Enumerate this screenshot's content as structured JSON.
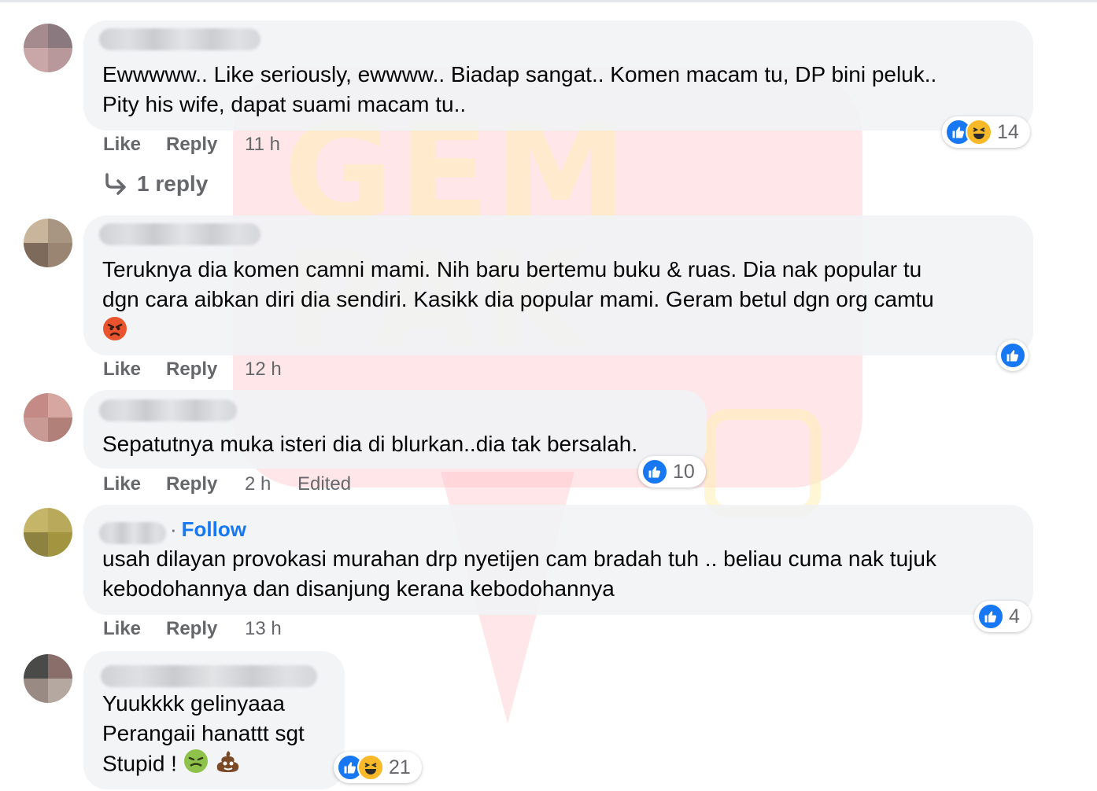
{
  "comments": [
    {
      "text_lines": [
        "Ewwwww.. Like seriously, ewwww.. Biadap sangat.. Komen macam tu, DP bini peluk..",
        "Pity his wife, dapat suami macam tu.."
      ],
      "like_label": "Like",
      "reply_label": "Reply",
      "time": "11 h",
      "reaction_count": "14",
      "reactions": [
        "like-icon",
        "haha-icon"
      ],
      "replies_link": "1 reply"
    },
    {
      "text_lines": [
        "Teruknya dia komen camni mami. Nih baru bertemu buku & ruas. Dia nak popular tu",
        "dgn cara aibkan diri dia sendiri. Kasikk dia popular mami. Geram betul dgn org camtu"
      ],
      "trailing_emoji": "angry-face-icon",
      "like_label": "Like",
      "reply_label": "Reply",
      "time": "12 h",
      "reactions": [
        "like-icon"
      ]
    },
    {
      "text_lines": [
        "Sepatutnya muka isteri dia di blurkan..dia tak bersalah."
      ],
      "like_label": "Like",
      "reply_label": "Reply",
      "time": "2 h",
      "edited_label": "Edited",
      "reaction_count": "10",
      "reactions": [
        "like-icon"
      ]
    },
    {
      "follow_label": "Follow",
      "text_lines": [
        "usah dilayan provokasi murahan drp nyetijen cam bradah tuh .. beliau cuma nak tujuk",
        "kebodohannya dan disanjung kerana kebodohannya"
      ],
      "like_label": "Like",
      "reply_label": "Reply",
      "time": "13 h",
      "reaction_count": "4",
      "reactions": [
        "like-icon"
      ]
    },
    {
      "text_lines": [
        "Yuukkkk gelinyaaa",
        "Perangaii hanattt sgt",
        "Stupid ! "
      ],
      "trailing_emoji": [
        "nauseated-face-icon",
        "pile-of-poo-icon"
      ],
      "reaction_count": "21",
      "reactions": [
        "like-icon",
        "haha-icon"
      ]
    }
  ],
  "colors": {
    "link": "#1877f2",
    "muted": "#65676b",
    "bubble": "#f0f2f5",
    "watermark_pink": "#ffc4c8"
  }
}
